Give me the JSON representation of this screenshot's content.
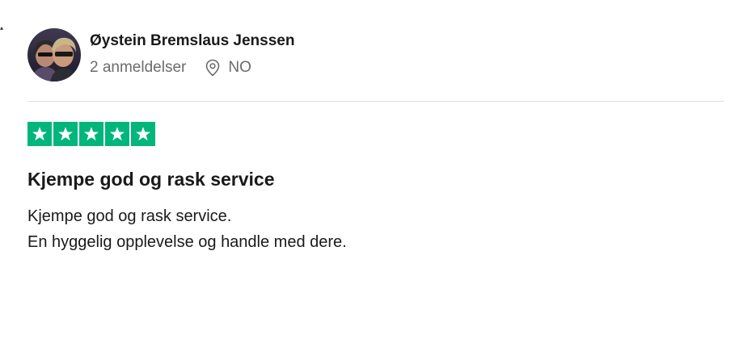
{
  "reviewer": {
    "name": "Øystein Bremslaus Jenssen",
    "review_count": "2 anmeldelser",
    "location_icon": "map-pin-icon",
    "country": "NO"
  },
  "rating": {
    "stars": 5,
    "max": 5,
    "color": "#00b67a",
    "icon": "star-icon"
  },
  "review": {
    "title": "Kjempe god og rask service",
    "body_lines": [
      "Kjempe god og rask service.",
      "En hyggelig opplevelse og handle med dere."
    ]
  }
}
